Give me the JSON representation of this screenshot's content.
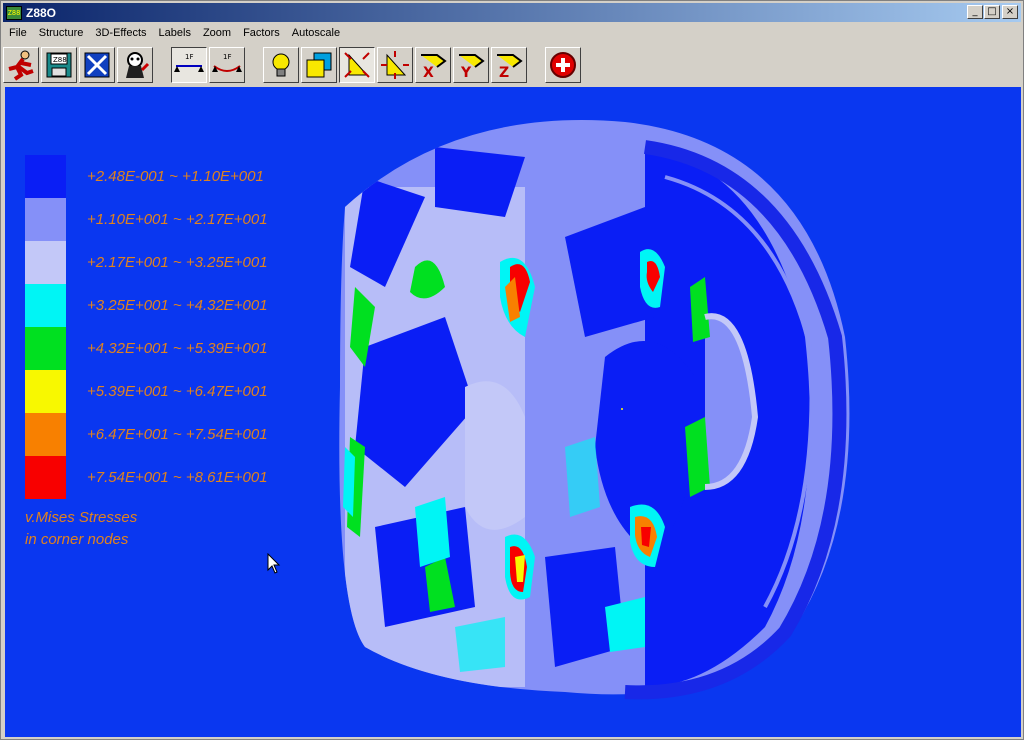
{
  "window": {
    "title": "Z88O",
    "icon_text": "Z88",
    "controls": {
      "minimize": "_",
      "maximize": "□",
      "close": "×"
    }
  },
  "menu": [
    "File",
    "Structure",
    "3D-Effects",
    "Labels",
    "Zoom",
    "Factors",
    "Autoscale"
  ],
  "toolbar": {
    "buttons": [
      {
        "name": "exit",
        "icon": "running-man-icon"
      },
      {
        "name": "save",
        "icon": "floppy-disk-icon",
        "text": "Z88"
      },
      {
        "name": "delete",
        "icon": "x-box-icon"
      },
      {
        "name": "help",
        "icon": "cartoon-dog-icon"
      },
      {
        "name": "undeformed",
        "icon": "undeformed-structure-icon",
        "text": "1F"
      },
      {
        "name": "deformed",
        "icon": "deformed-structure-icon",
        "text": "1F"
      },
      {
        "name": "light",
        "icon": "lightbulb-icon"
      },
      {
        "name": "layers",
        "icon": "stacked-cubes-icon"
      },
      {
        "name": "rotate-pan",
        "icon": "triangle-arrows-icon",
        "pressed": true
      },
      {
        "name": "rotate-zoom",
        "icon": "triangle-zoom-icon"
      },
      {
        "name": "rotate-x",
        "icon": "rotate-x-icon",
        "text": "X"
      },
      {
        "name": "rotate-y",
        "icon": "rotate-y-icon",
        "text": "Y"
      },
      {
        "name": "rotate-z",
        "icon": "rotate-z-icon",
        "text": "Z"
      },
      {
        "name": "stress-plot",
        "icon": "red-cross-icon"
      }
    ]
  },
  "legend": {
    "items": [
      {
        "range": "+2.48E-001 ~ +1.10E+001",
        "color": "#0a1ef5"
      },
      {
        "range": "+1.10E+001 ~ +2.17E+001",
        "color": "#8590f8"
      },
      {
        "range": "+2.17E+001 ~ +3.25E+001",
        "color": "#c3c8f8"
      },
      {
        "range": "+3.25E+001 ~ +4.32E+001",
        "color": "#00f5f5"
      },
      {
        "range": "+4.32E+001 ~ +5.39E+001",
        "color": "#00e020"
      },
      {
        "range": "+5.39E+001 ~ +6.47E+001",
        "color": "#f8f800"
      },
      {
        "range": "+6.47E+001 ~ +7.54E+001",
        "color": "#f88000"
      },
      {
        "range": "+7.54E+001 ~ +8.61E+001",
        "color": "#f80000"
      }
    ],
    "title_line1": "v.Mises Stresses",
    "title_line2": "in corner nodes"
  },
  "colors": {
    "background": "#0a37f0",
    "label": "#e0821e"
  }
}
